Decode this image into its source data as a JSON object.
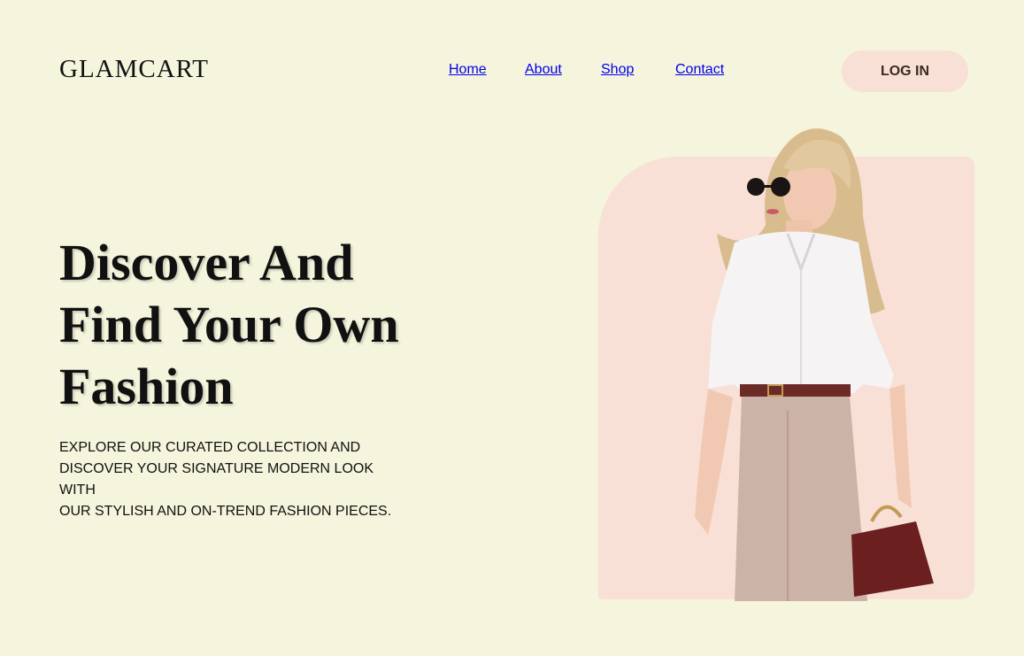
{
  "brand": {
    "logo": "GLAMCART"
  },
  "nav": {
    "items": [
      {
        "label": "Home"
      },
      {
        "label": "About"
      },
      {
        "label": "Shop"
      },
      {
        "label": "Contact"
      }
    ],
    "login_label": "LOG IN"
  },
  "hero": {
    "headline_lines": [
      "Discover And",
      "Find Your Own",
      "Fashion"
    ],
    "subtext_lines": [
      "EXPLORE OUR CURATED COLLECTION AND",
      "DISCOVER YOUR SIGNATURE MODERN LOOK WITH",
      "OUR STYLISH AND ON-TREND FASHION PIECES."
    ]
  },
  "colors": {
    "background": "#f5f4dc",
    "accent_pink": "#f8e0d6",
    "text": "#111111"
  }
}
